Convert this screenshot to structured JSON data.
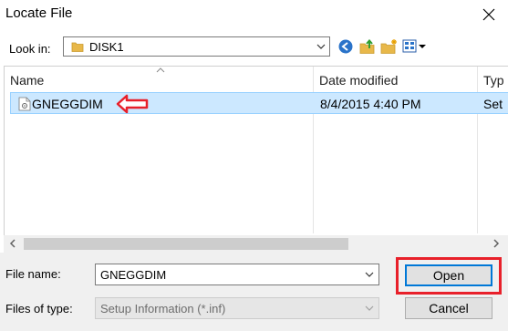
{
  "window": {
    "title": "Locate File"
  },
  "look_in": {
    "label": "Look in:",
    "value": "DISK1"
  },
  "toolbar": {
    "icons": [
      "back-icon",
      "up-folder-icon",
      "new-folder-icon",
      "view-menu-icon"
    ]
  },
  "columns": [
    {
      "label": "Name"
    },
    {
      "label": "Date modified"
    },
    {
      "label": "Typ"
    }
  ],
  "files": [
    {
      "name": "GNEGGDIM",
      "date_modified": "8/4/2015 4:40 PM",
      "type": "Set",
      "selected": true
    }
  ],
  "file_name": {
    "label": "File name:",
    "value": "GNEGGDIM"
  },
  "files_of_type": {
    "label": "Files of type:",
    "value": "Setup Information (*.inf)"
  },
  "buttons": {
    "open": "Open",
    "cancel": "Cancel"
  },
  "colors": {
    "selection": "#cce8ff",
    "selection_border": "#99d1ff",
    "annotation_red": "#e8202a",
    "focus_blue": "#0078d7"
  }
}
